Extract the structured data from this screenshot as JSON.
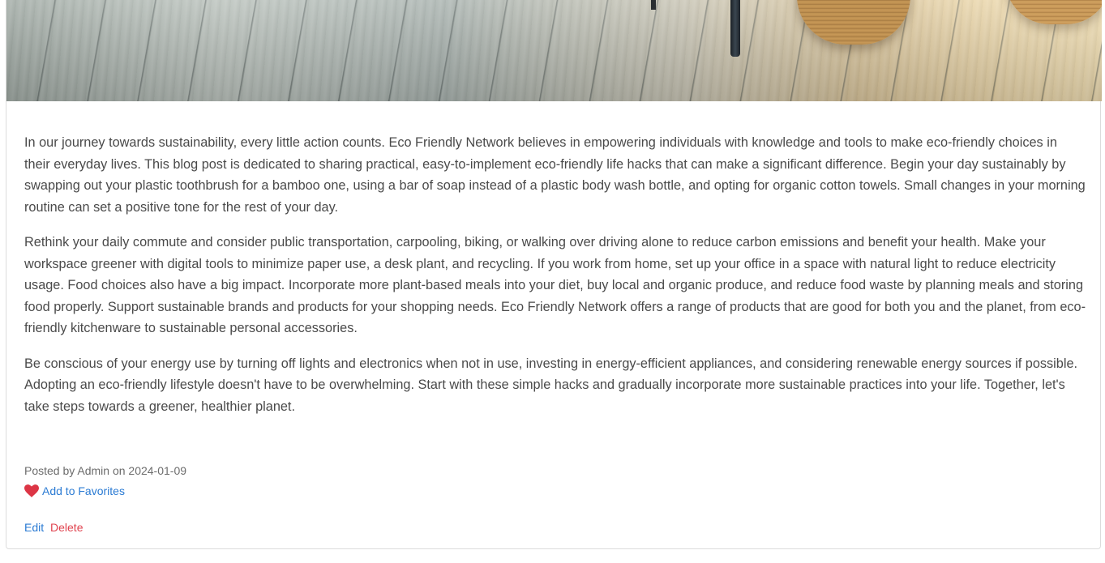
{
  "post": {
    "paragraphs": [
      "In our journey towards sustainability, every little action counts. Eco Friendly Network believes in empowering individuals with knowledge and tools to make eco-friendly choices in their everyday lives. This blog post is dedicated to sharing practical, easy-to-implement eco-friendly life hacks that can make a significant difference. Begin your day sustainably by swapping out your plastic toothbrush for a bamboo one, using a bar of soap instead of a plastic body wash bottle, and opting for organic cotton towels. Small changes in your morning routine can set a positive tone for the rest of your day.",
      "Rethink your daily commute and consider public transportation, carpooling, biking, or walking over driving alone to reduce carbon emissions and benefit your health. Make your workspace greener with digital tools to minimize paper use, a desk plant, and recycling. If you work from home, set up your office in a space with natural light to reduce electricity usage. Food choices also have a big impact. Incorporate more plant-based meals into your diet, buy local and organic produce, and reduce food waste by planning meals and storing food properly. Support sustainable brands and products for your shopping needs. Eco Friendly Network offers a range of products that are good for both you and the planet, from eco-friendly kitchenware to sustainable personal accessories.",
      "Be conscious of your energy use by turning off lights and electronics when not in use, investing in energy-efficient appliances, and considering renewable energy sources if possible. Adopting an eco-friendly lifestyle doesn't have to be overwhelming. Start with these simple hacks and gradually incorporate more sustainable practices into your life. Together, let's take steps towards a greener, healthier planet."
    ],
    "meta": "Posted by Admin on 2024-01-09",
    "favorite_label": "Add to Favorites",
    "favorite_icon": "heart-icon",
    "edit_label": "Edit",
    "delete_label": "Delete"
  },
  "colors": {
    "link": "#2b7bd3",
    "danger": "#e0434f",
    "heart": "#dc3545",
    "text": "#4a4a4a"
  }
}
